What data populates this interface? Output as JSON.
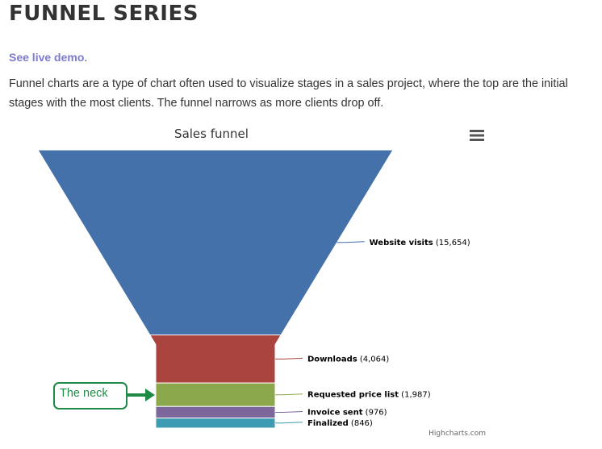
{
  "page": {
    "heading": "FUNNEL SERIES",
    "demo_link": "See live demo",
    "demo_suffix": ".",
    "description": "Funnel charts are a type of chart often used to visualize stages in a sales project, where the top are the initial stages with the most clients. The funnel narrows as more clients drop off."
  },
  "annotation": {
    "label": "The neck",
    "color": "#1e8a45"
  },
  "chart_data": {
    "type": "funnel",
    "title": "Sales funnel",
    "credits": "Highcharts.com",
    "menu_icon": "hamburger-menu-icon",
    "points": [
      {
        "name": "Website visits",
        "value": 15654,
        "label": "(15,654)",
        "color": "#4471a9"
      },
      {
        "name": "Downloads",
        "value": 4064,
        "label": "(4,064)",
        "color": "#a9443e"
      },
      {
        "name": "Requested price list",
        "value": 1987,
        "label": "(1,987)",
        "color": "#8ba84c"
      },
      {
        "name": "Invoice sent",
        "value": 976,
        "label": "(976)",
        "color": "#7c669b"
      },
      {
        "name": "Finalized",
        "value": 846,
        "label": "(846)",
        "color": "#3d9bb2"
      }
    ]
  }
}
